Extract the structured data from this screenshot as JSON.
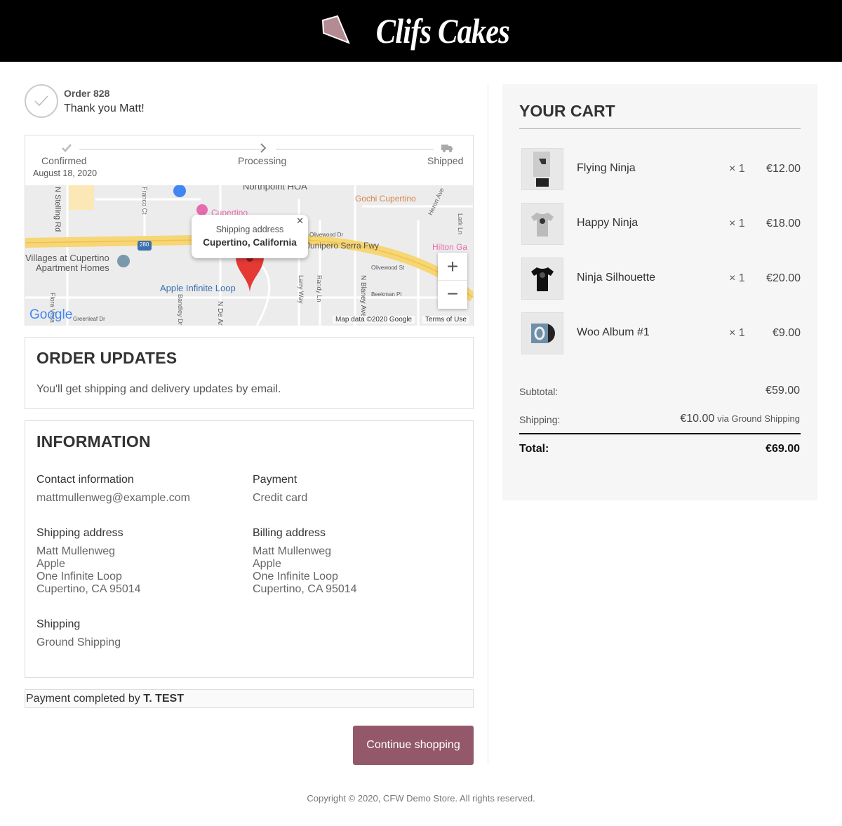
{
  "brand": {
    "name": "Clifs Cakes",
    "logo_color": "#b48a93"
  },
  "order": {
    "number": "Order 828",
    "thanks": "Thank you Matt!"
  },
  "tracker": {
    "steps": [
      {
        "label": "Confirmed",
        "date": "August 18, 2020",
        "icon": "check-icon"
      },
      {
        "label": "Processing",
        "icon": "chevron-right-icon"
      },
      {
        "label": "Shipped",
        "icon": "truck-icon"
      }
    ]
  },
  "map": {
    "popup_title": "Shipping address",
    "popup_value": "Cupertino, California",
    "attribution": "Map data ©2020 Google",
    "terms": "Terms of Use",
    "google": "Google",
    "labels": [
      "N Stelling Rd",
      "Franco Ct",
      "Northpoint HOA",
      "Gochi Cupertino",
      "Heron Ave",
      "Lark Ln",
      "Cupertino",
      "280",
      "Villages at Cupertino",
      "Apartment Homes",
      "Apple Infinite Loop",
      "Junipero Serra Fwy",
      "Hilton Ga",
      "Olivewood St",
      "Beekman Pl",
      "N Blaney Ave",
      "Larry Way",
      "Randy Ln",
      "Bandley Dr",
      "N De Anza",
      "Flora Vista",
      "Greenleaf Dr",
      "Infinite Loop",
      "Olivewood Dr"
    ]
  },
  "updates": {
    "title": "ORDER UPDATES",
    "text": "You'll get shipping and delivery updates by email."
  },
  "information": {
    "title": "INFORMATION",
    "contact": {
      "label": "Contact information",
      "value": "mattmullenweg@example.com"
    },
    "payment": {
      "label": "Payment",
      "value": "Credit card"
    },
    "shipping_address": {
      "label": "Shipping address",
      "lines": [
        "Matt Mullenweg",
        "Apple",
        "One Infinite Loop",
        "Cupertino, CA 95014"
      ]
    },
    "billing_address": {
      "label": "Billing address",
      "lines": [
        "Matt Mullenweg",
        "Apple",
        "One Infinite Loop",
        "Cupertino, CA 95014"
      ]
    },
    "shipping": {
      "label": "Shipping",
      "value": "Ground Shipping"
    }
  },
  "payment_note": {
    "prefix": "Payment completed by ",
    "name": "T. TEST"
  },
  "continue_label": "Continue shopping",
  "cart": {
    "title": "YOUR CART",
    "items": [
      {
        "name": "Flying Ninja",
        "qty": "× 1",
        "price": "€12.00",
        "thumb": "poster"
      },
      {
        "name": "Happy Ninja",
        "qty": "× 1",
        "price": "€18.00",
        "thumb": "grey-tshirt"
      },
      {
        "name": "Ninja Silhouette",
        "qty": "× 1",
        "price": "€20.00",
        "thumb": "black-tshirt"
      },
      {
        "name": "Woo Album #1",
        "qty": "× 1",
        "price": "€9.00",
        "thumb": "album"
      }
    ],
    "subtotal_label": "Subtotal:",
    "subtotal": "€59.00",
    "shipping_label": "Shipping:",
    "shipping_price": "€10.00",
    "shipping_method": "via Ground Shipping",
    "total_label": "Total:",
    "total": "€69.00"
  },
  "footer": "Copyright © 2020, CFW Demo Store. All rights reserved.",
  "colors": {
    "accent": "#93596a",
    "header_bg": "#000000",
    "cart_bg": "#f6f6f6"
  }
}
